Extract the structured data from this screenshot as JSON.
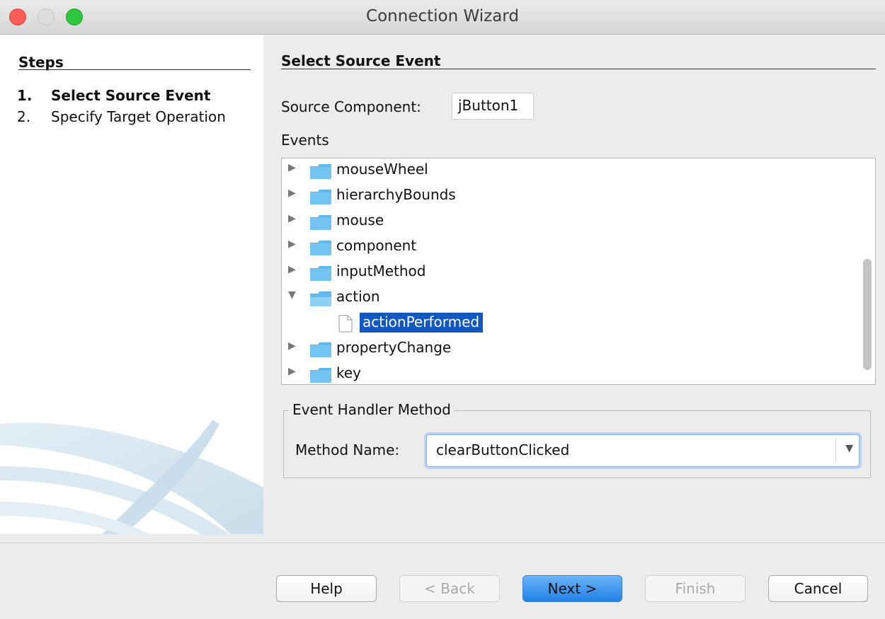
{
  "window": {
    "title": "Connection Wizard"
  },
  "steps": {
    "heading": "Steps",
    "items": [
      {
        "num": "1.",
        "label": "Select Source Event"
      },
      {
        "num": "2.",
        "label": "Specify Target Operation"
      }
    ]
  },
  "main": {
    "heading": "Select Source Event",
    "source_component_label": "Source Component:",
    "source_component_value": "jButton1",
    "events_label": "Events",
    "events": [
      {
        "label": "mouseWheel"
      },
      {
        "label": "hierarchyBounds"
      },
      {
        "label": "mouse"
      },
      {
        "label": "component"
      },
      {
        "label": "inputMethod"
      },
      {
        "label": "action",
        "expanded": true,
        "children": [
          {
            "label": "actionPerformed",
            "selected": true
          }
        ]
      },
      {
        "label": "propertyChange"
      },
      {
        "label": "key"
      }
    ],
    "handler_group_label": "Event Handler Method",
    "method_name_label": "Method Name:",
    "method_name_value": "clearButtonClicked"
  },
  "footer": {
    "help": "Help",
    "back": "< Back",
    "next": "Next >",
    "finish": "Finish",
    "cancel": "Cancel"
  },
  "colors": {
    "selection": "#1357c2",
    "folder": "#5fb8ef",
    "default_button": "#2f8ef0"
  }
}
